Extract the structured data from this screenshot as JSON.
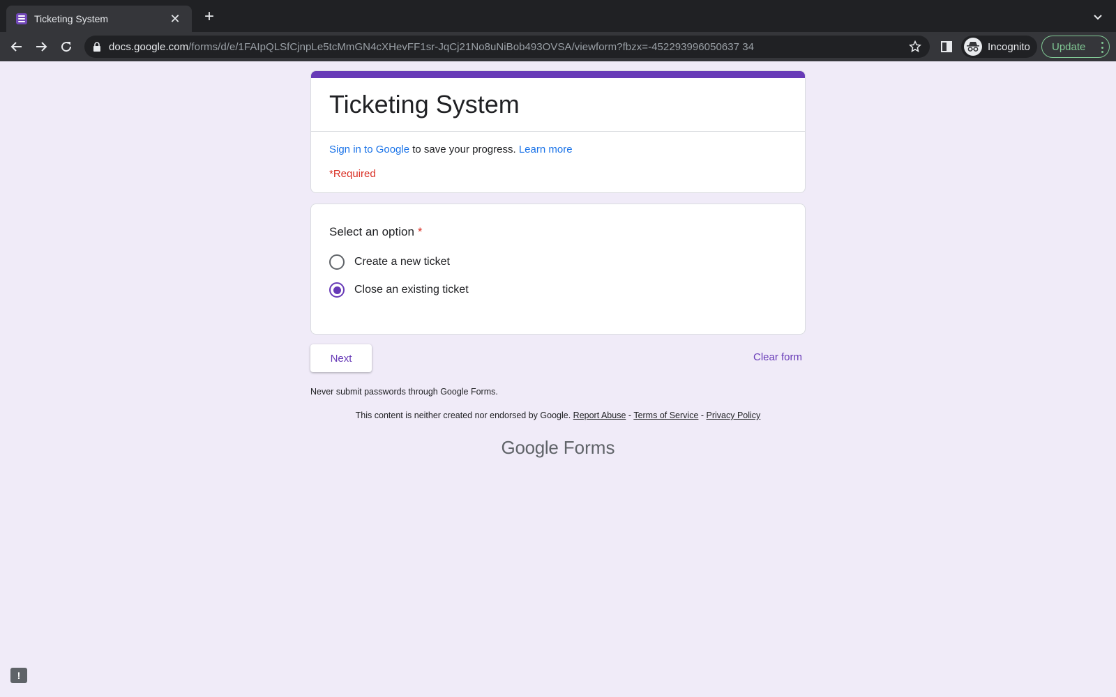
{
  "browser": {
    "tab_title": "Ticketing System",
    "url_host": "docs.google.com",
    "url_path": "/forms/d/e/1FAIpQLSfCjnpLe5tcMmGN4cXHevFF1sr-JqCj21No8uNiBob493OVSA/viewform?fbzx=-452293996050637 34",
    "profile_label": "Incognito",
    "update_label": "Update"
  },
  "form": {
    "title": "Ticketing System",
    "signin_link": "Sign in to Google",
    "signin_text": " to save your progress. ",
    "learn_more": "Learn more",
    "required_note": "*Required",
    "question": {
      "title": "Select an option",
      "required_mark": "*",
      "options": [
        {
          "label": "Create a new ticket",
          "selected": false
        },
        {
          "label": "Close an existing ticket",
          "selected": true
        }
      ]
    },
    "next_label": "Next",
    "clear_label": "Clear form"
  },
  "footer": {
    "never_submit": "Never submit passwords through Google Forms.",
    "disclaimer_text": "This content is neither created nor endorsed by Google. ",
    "report_abuse": "Report Abuse",
    "sep1": " - ",
    "terms": "Terms of Service",
    "sep2": " - ",
    "privacy": "Privacy Policy",
    "logo_google": "Google",
    "logo_forms": "Forms"
  },
  "colors": {
    "accent": "#673ab7",
    "background": "#f0ebf8",
    "required": "#d93025",
    "link": "#1a73e8"
  }
}
